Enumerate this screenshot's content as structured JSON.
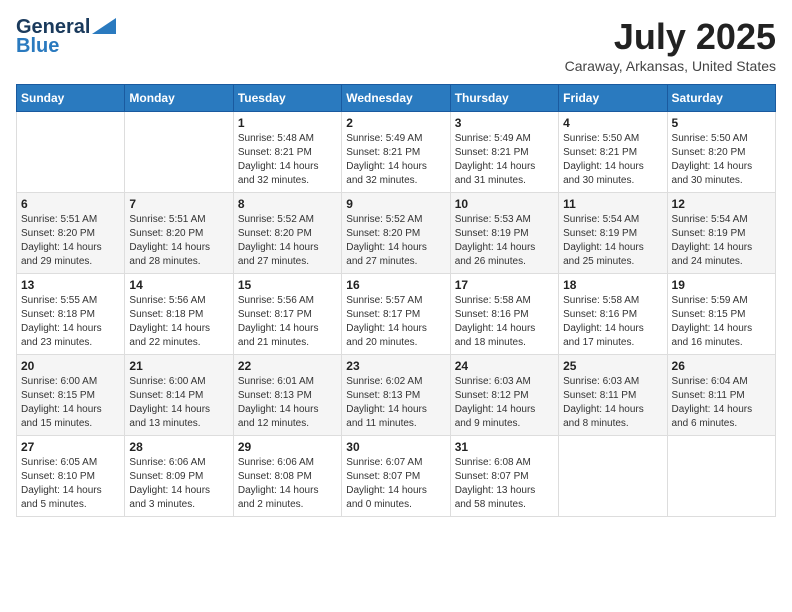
{
  "header": {
    "logo_line1": "General",
    "logo_line2": "Blue",
    "month": "July 2025",
    "location": "Caraway, Arkansas, United States"
  },
  "days_of_week": [
    "Sunday",
    "Monday",
    "Tuesday",
    "Wednesday",
    "Thursday",
    "Friday",
    "Saturday"
  ],
  "weeks": [
    [
      {
        "day": "",
        "info": ""
      },
      {
        "day": "",
        "info": ""
      },
      {
        "day": "1",
        "info": "Sunrise: 5:48 AM\nSunset: 8:21 PM\nDaylight: 14 hours and 32 minutes."
      },
      {
        "day": "2",
        "info": "Sunrise: 5:49 AM\nSunset: 8:21 PM\nDaylight: 14 hours and 32 minutes."
      },
      {
        "day": "3",
        "info": "Sunrise: 5:49 AM\nSunset: 8:21 PM\nDaylight: 14 hours and 31 minutes."
      },
      {
        "day": "4",
        "info": "Sunrise: 5:50 AM\nSunset: 8:21 PM\nDaylight: 14 hours and 30 minutes."
      },
      {
        "day": "5",
        "info": "Sunrise: 5:50 AM\nSunset: 8:20 PM\nDaylight: 14 hours and 30 minutes."
      }
    ],
    [
      {
        "day": "6",
        "info": "Sunrise: 5:51 AM\nSunset: 8:20 PM\nDaylight: 14 hours and 29 minutes."
      },
      {
        "day": "7",
        "info": "Sunrise: 5:51 AM\nSunset: 8:20 PM\nDaylight: 14 hours and 28 minutes."
      },
      {
        "day": "8",
        "info": "Sunrise: 5:52 AM\nSunset: 8:20 PM\nDaylight: 14 hours and 27 minutes."
      },
      {
        "day": "9",
        "info": "Sunrise: 5:52 AM\nSunset: 8:20 PM\nDaylight: 14 hours and 27 minutes."
      },
      {
        "day": "10",
        "info": "Sunrise: 5:53 AM\nSunset: 8:19 PM\nDaylight: 14 hours and 26 minutes."
      },
      {
        "day": "11",
        "info": "Sunrise: 5:54 AM\nSunset: 8:19 PM\nDaylight: 14 hours and 25 minutes."
      },
      {
        "day": "12",
        "info": "Sunrise: 5:54 AM\nSunset: 8:19 PM\nDaylight: 14 hours and 24 minutes."
      }
    ],
    [
      {
        "day": "13",
        "info": "Sunrise: 5:55 AM\nSunset: 8:18 PM\nDaylight: 14 hours and 23 minutes."
      },
      {
        "day": "14",
        "info": "Sunrise: 5:56 AM\nSunset: 8:18 PM\nDaylight: 14 hours and 22 minutes."
      },
      {
        "day": "15",
        "info": "Sunrise: 5:56 AM\nSunset: 8:17 PM\nDaylight: 14 hours and 21 minutes."
      },
      {
        "day": "16",
        "info": "Sunrise: 5:57 AM\nSunset: 8:17 PM\nDaylight: 14 hours and 20 minutes."
      },
      {
        "day": "17",
        "info": "Sunrise: 5:58 AM\nSunset: 8:16 PM\nDaylight: 14 hours and 18 minutes."
      },
      {
        "day": "18",
        "info": "Sunrise: 5:58 AM\nSunset: 8:16 PM\nDaylight: 14 hours and 17 minutes."
      },
      {
        "day": "19",
        "info": "Sunrise: 5:59 AM\nSunset: 8:15 PM\nDaylight: 14 hours and 16 minutes."
      }
    ],
    [
      {
        "day": "20",
        "info": "Sunrise: 6:00 AM\nSunset: 8:15 PM\nDaylight: 14 hours and 15 minutes."
      },
      {
        "day": "21",
        "info": "Sunrise: 6:00 AM\nSunset: 8:14 PM\nDaylight: 14 hours and 13 minutes."
      },
      {
        "day": "22",
        "info": "Sunrise: 6:01 AM\nSunset: 8:13 PM\nDaylight: 14 hours and 12 minutes."
      },
      {
        "day": "23",
        "info": "Sunrise: 6:02 AM\nSunset: 8:13 PM\nDaylight: 14 hours and 11 minutes."
      },
      {
        "day": "24",
        "info": "Sunrise: 6:03 AM\nSunset: 8:12 PM\nDaylight: 14 hours and 9 minutes."
      },
      {
        "day": "25",
        "info": "Sunrise: 6:03 AM\nSunset: 8:11 PM\nDaylight: 14 hours and 8 minutes."
      },
      {
        "day": "26",
        "info": "Sunrise: 6:04 AM\nSunset: 8:11 PM\nDaylight: 14 hours and 6 minutes."
      }
    ],
    [
      {
        "day": "27",
        "info": "Sunrise: 6:05 AM\nSunset: 8:10 PM\nDaylight: 14 hours and 5 minutes."
      },
      {
        "day": "28",
        "info": "Sunrise: 6:06 AM\nSunset: 8:09 PM\nDaylight: 14 hours and 3 minutes."
      },
      {
        "day": "29",
        "info": "Sunrise: 6:06 AM\nSunset: 8:08 PM\nDaylight: 14 hours and 2 minutes."
      },
      {
        "day": "30",
        "info": "Sunrise: 6:07 AM\nSunset: 8:07 PM\nDaylight: 14 hours and 0 minutes."
      },
      {
        "day": "31",
        "info": "Sunrise: 6:08 AM\nSunset: 8:07 PM\nDaylight: 13 hours and 58 minutes."
      },
      {
        "day": "",
        "info": ""
      },
      {
        "day": "",
        "info": ""
      }
    ]
  ]
}
